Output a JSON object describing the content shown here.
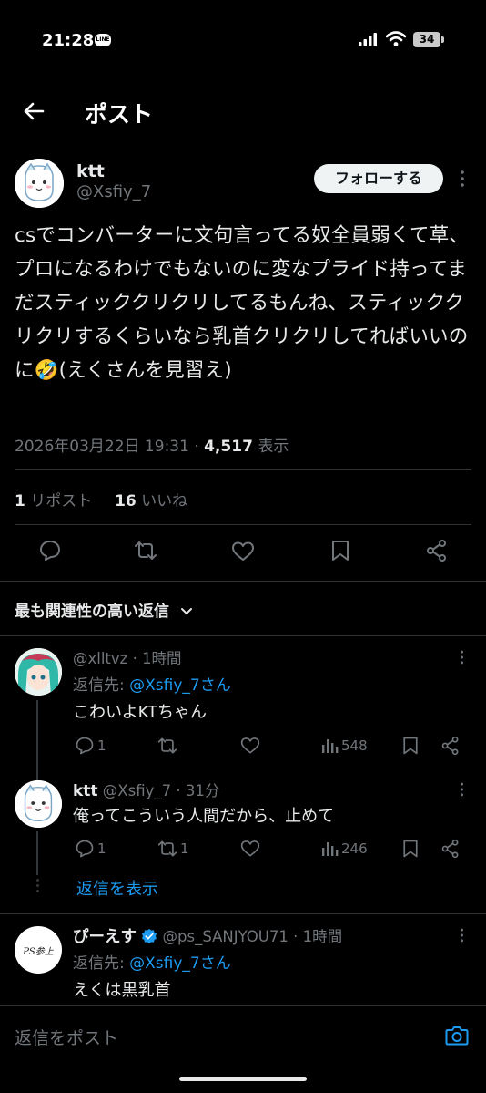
{
  "status_bar": {
    "time": "21:28",
    "line_label": "LINE",
    "battery": "34"
  },
  "header": {
    "title": "ポスト"
  },
  "post": {
    "display_name": "ktt",
    "handle": "@Xsfiy_7",
    "follow_label": "フォローする",
    "text": "csでコンバーターに文句言ってる奴全員弱くて草、プロになるわけでもないのに変なプライド持ってまだスティッククリクリしてるもんね、スティッククリクリするくらいなら乳首クリクリしてればいいのに🤣(えくさんを見習え)",
    "timestamp": "2026年03月22日 19:31 · ",
    "views_count": "4,517",
    "views_label": " 表示",
    "reposts_count": "1",
    "reposts_label": " リポスト",
    "likes_count": "16",
    "likes_label": " いいね"
  },
  "sort": {
    "label": "最も関連性の高い返信"
  },
  "replies": [
    {
      "handle": "@xlltvz",
      "time": " · 1時間",
      "reply_to_prefix": "返信先: ",
      "reply_to_user": "@Xsfiy_7さん",
      "text": "こわいよKTちゃん",
      "reply_count": "1",
      "repost_count": "",
      "views": "548"
    },
    {
      "display_name": "ktt",
      "handle": " @Xsfiy_7",
      "time": " · 31分",
      "text": "俺ってこういう人間だから、止めて",
      "reply_count": "1",
      "repost_count": "1",
      "views": "246"
    },
    {
      "display_name": "ぴーえす",
      "handle": "@ps_SANJYOU71",
      "time": " · 1時間",
      "reply_to_prefix": "返信先: ",
      "reply_to_user": "@Xsfiy_7さん",
      "text": "えくは黒乳首",
      "avatar_text": "PS参上"
    }
  ],
  "show_replies": {
    "label": "返信を表示"
  },
  "reply_input": {
    "placeholder": "返信をポスト"
  },
  "colors": {
    "accent": "#1d9bf0",
    "background": "#000000",
    "muted": "#71767b"
  }
}
